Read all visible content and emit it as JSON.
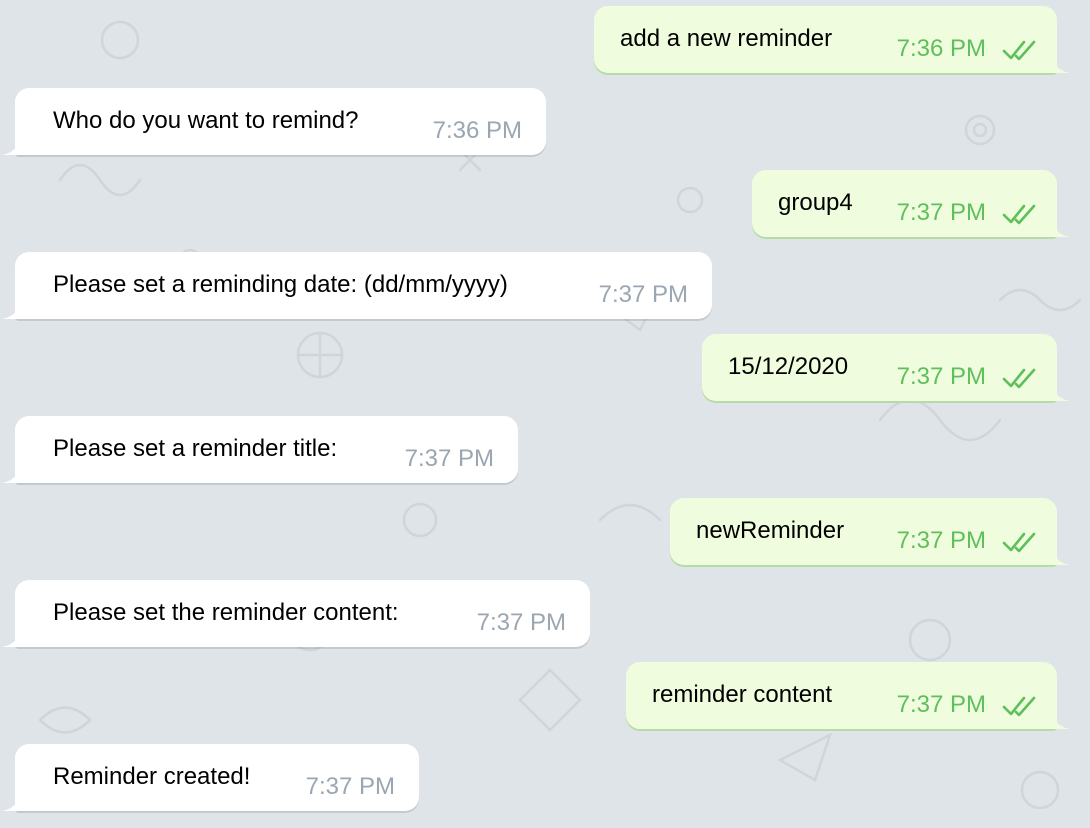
{
  "theme": {
    "background": "#dfe4e8",
    "outgoing_bubble": "#effdde",
    "incoming_bubble": "#ffffff",
    "outgoing_time_color": "#5fbf5a",
    "incoming_time_color": "#9aa6b1",
    "read_receipt_icon": "double-check-icon"
  },
  "messages": [
    {
      "direction": "outgoing",
      "text": "add a new reminder",
      "time": "7:36 PM",
      "status": "read"
    },
    {
      "direction": "incoming",
      "text": "Who do you want to remind?",
      "time": "7:36 PM"
    },
    {
      "direction": "outgoing",
      "text": "group4",
      "time": "7:37 PM",
      "status": "read"
    },
    {
      "direction": "incoming",
      "text": "Please set a reminding date: (dd/mm/yyyy)",
      "time": "7:37 PM"
    },
    {
      "direction": "outgoing",
      "text": "15/12/2020",
      "time": "7:37 PM",
      "status": "read"
    },
    {
      "direction": "incoming",
      "text": "Please set a reminder title:",
      "time": "7:37 PM"
    },
    {
      "direction": "outgoing",
      "text": "newReminder",
      "time": "7:37 PM",
      "status": "read"
    },
    {
      "direction": "incoming",
      "text": "Please set the reminder content:",
      "time": "7:37 PM"
    },
    {
      "direction": "outgoing",
      "text": "reminder content",
      "time": "7:37 PM",
      "status": "read"
    },
    {
      "direction": "incoming",
      "text": "Reminder created!",
      "time": "7:37 PM"
    }
  ]
}
